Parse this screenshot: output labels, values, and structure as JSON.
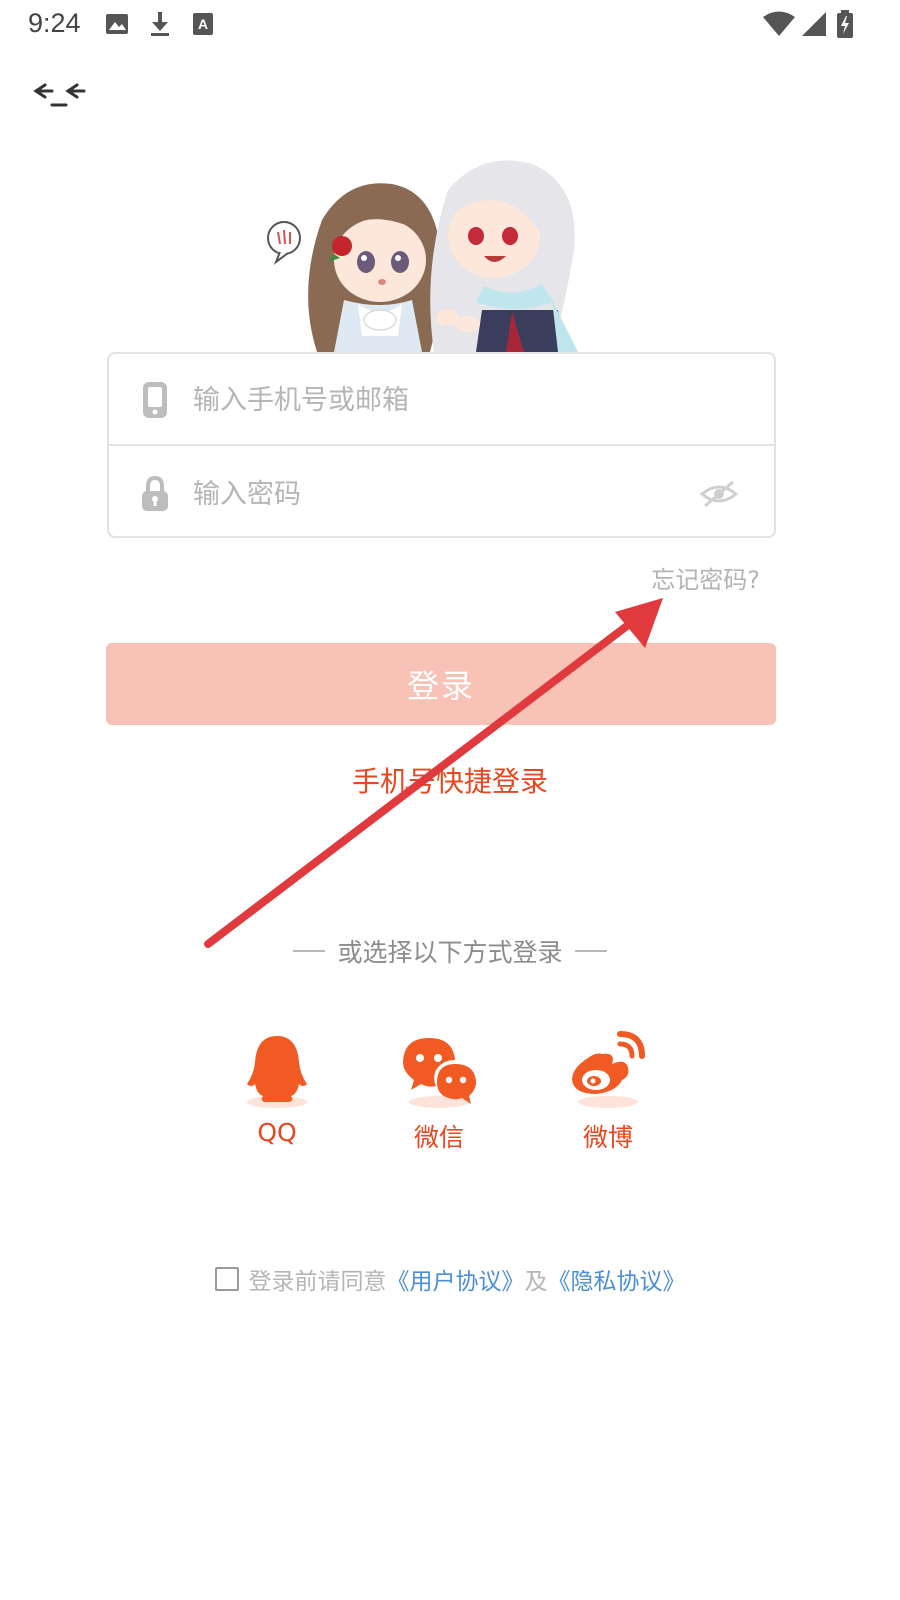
{
  "status_bar": {
    "time": "9:24",
    "left_icons": [
      "image-icon",
      "download-icon",
      "font-icon"
    ],
    "right_icons": [
      "wifi-icon",
      "signal-icon",
      "battery-charging-icon"
    ]
  },
  "nav": {
    "back_icon": "back-icon"
  },
  "login_form": {
    "account_field": {
      "placeholder": "输入手机号或邮箱",
      "value": "",
      "icon": "phone-icon"
    },
    "password_field": {
      "placeholder": "输入密码",
      "value": "",
      "icon": "lock-icon",
      "toggle_icon": "eye-off-icon"
    },
    "forgot_password": "忘记密码?",
    "login_button": "登录",
    "quick_login": "手机号快捷登录"
  },
  "alt_login": {
    "divider_text": "或选择以下方式登录",
    "providers": [
      {
        "label": "QQ",
        "icon": "qq-icon"
      },
      {
        "label": "微信",
        "icon": "wechat-icon"
      },
      {
        "label": "微博",
        "icon": "weibo-icon"
      }
    ]
  },
  "agreement": {
    "checked": false,
    "prefix": "登录前请同意",
    "user_agreement": "《用户协议》",
    "conjunction": "及",
    "privacy_agreement": "《隐私协议》"
  },
  "colors": {
    "accent": "#e8471f",
    "login_button_bg": "#f8c2b7",
    "link_blue": "#4c8fd9",
    "annotation_arrow": "#e53e3e"
  }
}
